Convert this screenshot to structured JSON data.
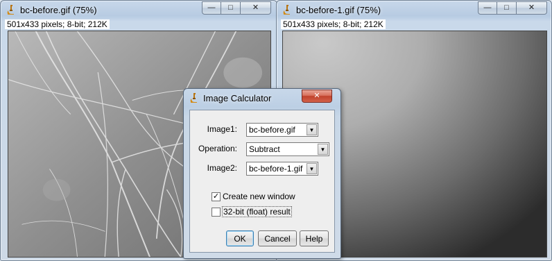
{
  "windows": [
    {
      "title": "bc-before.gif (75%)",
      "info": "501x433 pixels; 8-bit; 212K",
      "caption_buttons": [
        "minimize",
        "maximize",
        "close"
      ]
    },
    {
      "title": "bc-before-1.gif (75%)",
      "info": "501x433 pixels; 8-bit; 212K",
      "caption_buttons": [
        "minimize",
        "maximize",
        "close"
      ]
    }
  ],
  "dialog": {
    "title": "Image Calculator",
    "image1_label": "Image1:",
    "image1_value": "bc-before.gif",
    "operation_label": "Operation:",
    "operation_value": "Subtract",
    "image2_label": "Image2:",
    "image2_value": "bc-before-1.gif",
    "create_new_window": {
      "label": "Create new window",
      "checked": true
    },
    "float_result": {
      "label": "32-bit (float) result",
      "checked": false
    },
    "ok_label": "OK",
    "cancel_label": "Cancel",
    "help_label": "Help"
  },
  "colors": {
    "titlebar": "#bccfe4",
    "close_button": "#c7432d",
    "dialog_body": "#eeeeee",
    "default_button_border": "#3c7fb1"
  }
}
